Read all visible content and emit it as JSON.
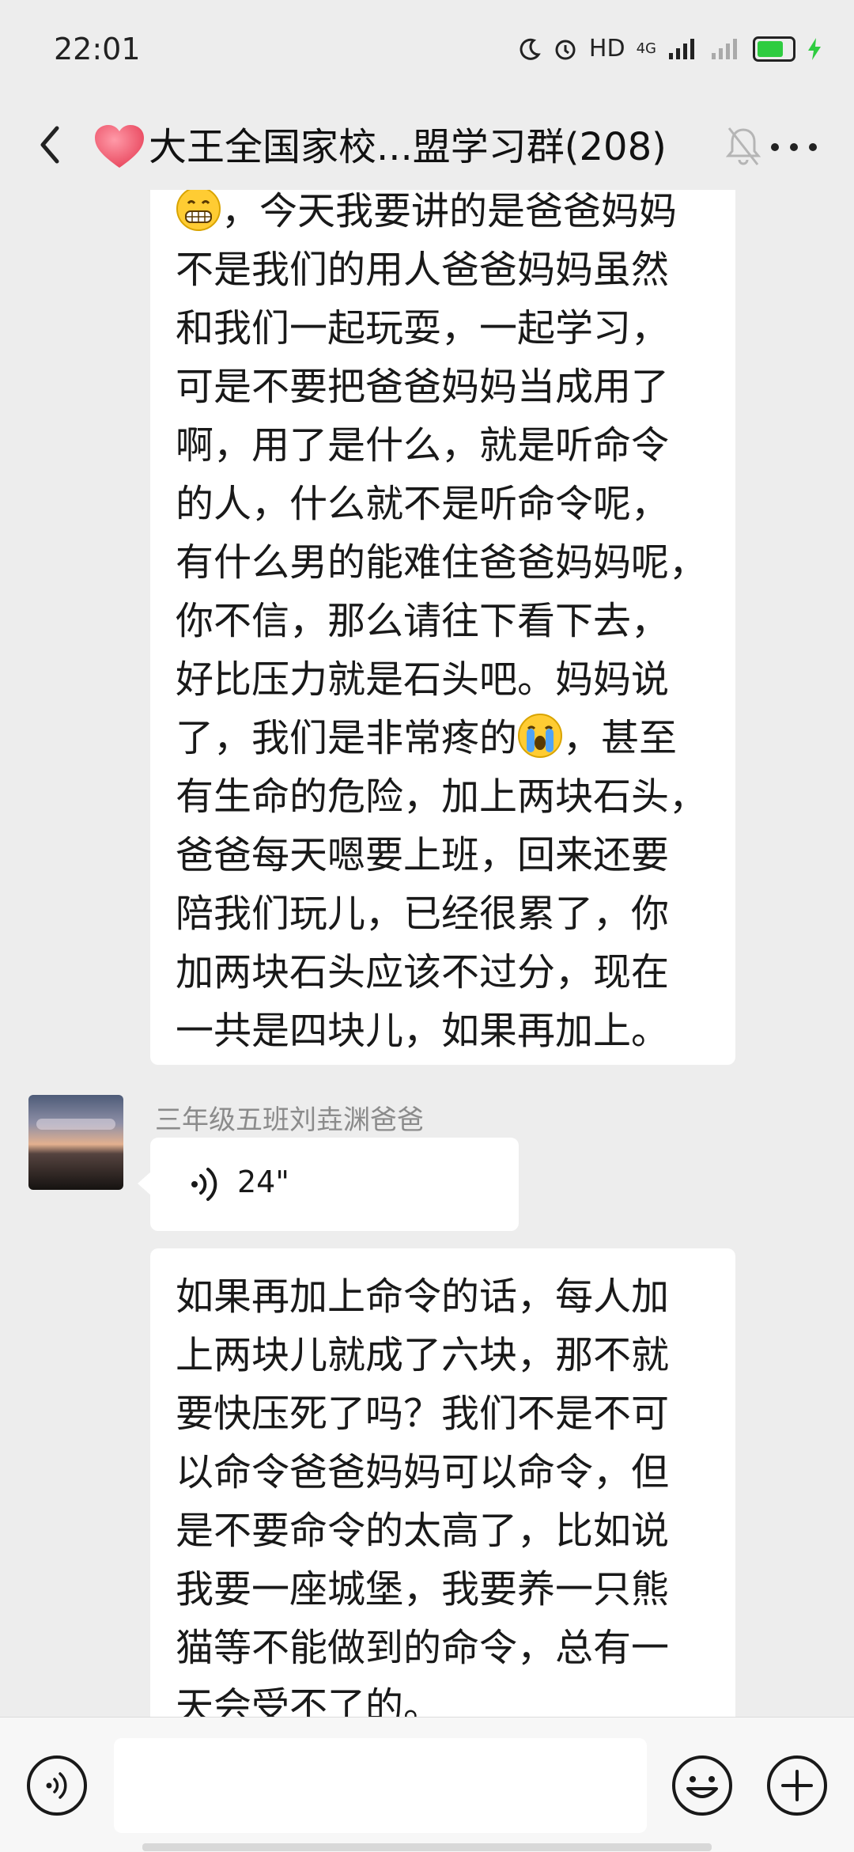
{
  "status_bar": {
    "time": "22:01",
    "network_label": "HD",
    "signal_label": "4G",
    "icons": [
      "moon-icon",
      "alarm-icon",
      "signal-icon",
      "battery-icon",
      "charging-icon"
    ],
    "battery_fraction": 0.9
  },
  "header": {
    "title": "大王全国家校...盟学习群(208)",
    "icons": [
      "back-icon",
      "heart-icon",
      "mute-bell-icon",
      "more-icon"
    ]
  },
  "messages": [
    {
      "type": "text",
      "lines": [
        "，今天我要讲的是爸爸妈妈",
        "不是我们的用人爸爸妈妈虽然",
        "和我们一起玩耍，一起学习，",
        "可是不要把爸爸妈妈当成用了",
        "啊，用了是什么，就是听命令",
        "的人，什么就不是听命令呢，",
        "有什么男的能难住爸爸妈妈呢，",
        "你不信，那么请往下看下去，",
        "好比压力就是石头吧。妈妈说",
        "了，我们是非常疼的",
        "，甚至",
        "有生命的危险，加上两块石头，",
        "爸爸每天嗯要上班，回来还要",
        "陪我们玩儿，已经很累了，你",
        "加两块石头应该不过分，现在",
        "一共是四块儿，如果再加上。"
      ]
    },
    {
      "type": "voice",
      "sender": "三年级五班刘垚渊爸爸",
      "duration": "24\""
    },
    {
      "type": "text",
      "lines": [
        "如果再加上命令的话，每人加",
        "上两块儿就成了六块，那不就",
        "要快压死了吗？我们不是不可",
        "以命令爸爸妈妈可以命令，但",
        "是不要命令的太高了，比如说",
        "我要一座城堡，我要养一只熊",
        "猫等不能做到的命令，总有一",
        "天会受不了的。"
      ]
    }
  ],
  "input_bar": {
    "icons": [
      "voice-toggle-icon",
      "emoji-icon",
      "plus-icon"
    ],
    "placeholder": ""
  },
  "colors": {
    "background": "#ededed",
    "bubble": "#ffffff",
    "sender_name": "#8b8b8b",
    "battery": "#2ecc40"
  }
}
